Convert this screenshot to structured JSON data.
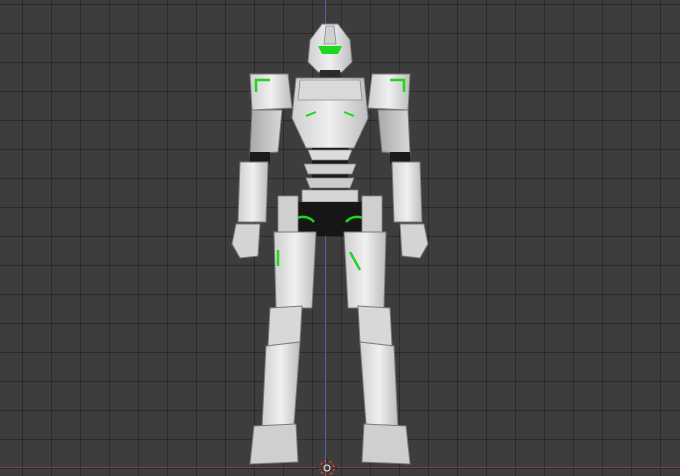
{
  "viewport": {
    "view": "front-orthographic",
    "icons": {
      "cursor": "3d-cursor-icon",
      "origin": "origin-icon"
    }
  },
  "colors": {
    "background": "#3d3d3d",
    "grid_line": "#2c2c2c",
    "axis_y": "#5b5ba8",
    "axis_x": "#8a3c3c",
    "armor_light": "#e6e6e6",
    "armor_mid": "#bfbfbf",
    "armor_dark": "#8f8f8f",
    "joint_black": "#141414",
    "accent_green": "#1fd620",
    "cursor_red": "#e0402e"
  },
  "model": {
    "type": "mecha-robot",
    "pose": "t-stand",
    "accent": "green"
  }
}
